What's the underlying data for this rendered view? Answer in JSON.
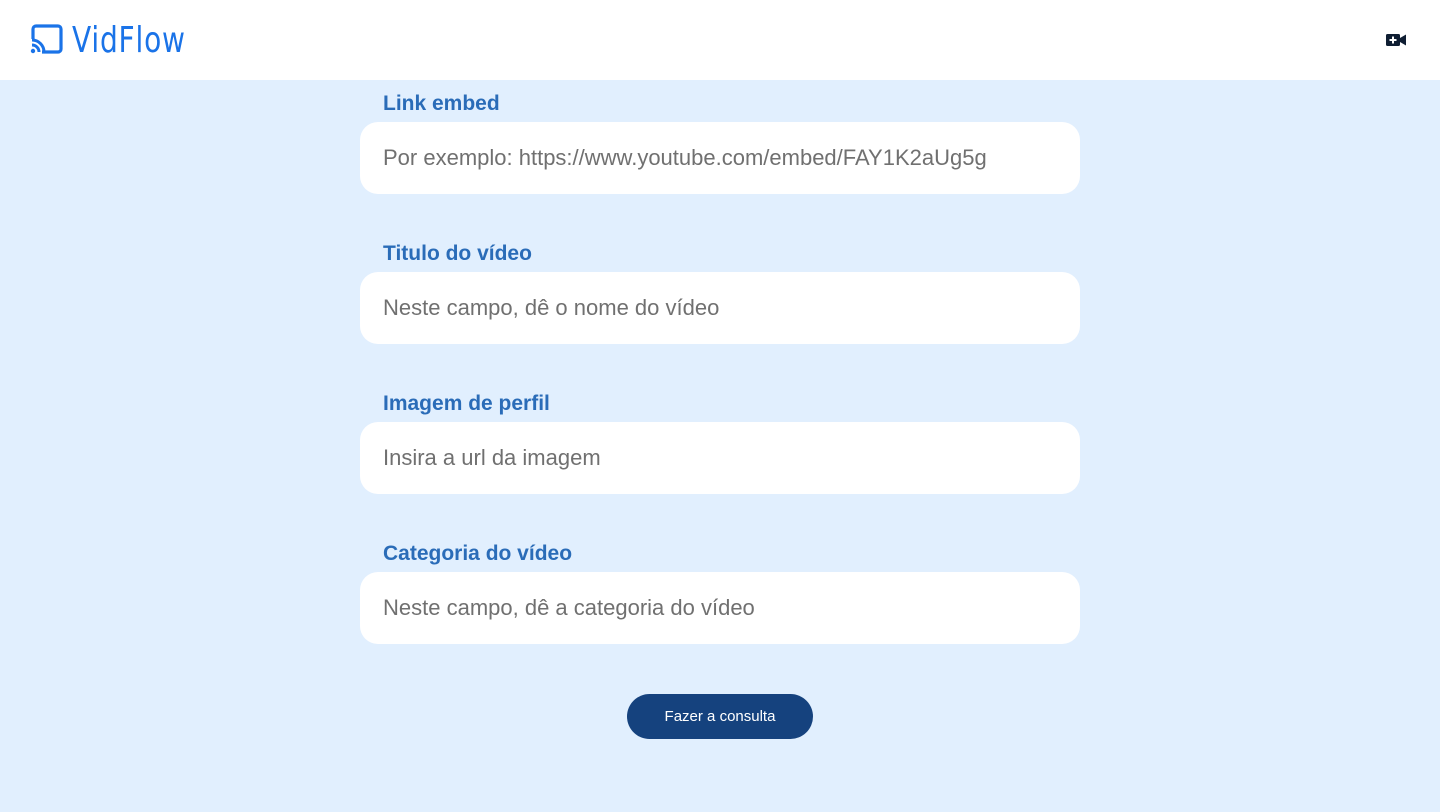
{
  "header": {
    "logo_text": "VidFlow",
    "logo_icon": "cast-icon",
    "new_video_icon": "video-camera-add-icon",
    "brand_color": "#1a73e8"
  },
  "form": {
    "fields": [
      {
        "label": "Link embed",
        "placeholder": "Por exemplo: https://www.youtube.com/embed/FAY1K2aUg5g"
      },
      {
        "label": "Titulo do vídeo",
        "placeholder": "Neste campo, dê o nome do vídeo"
      },
      {
        "label": "Imagem de perfil",
        "placeholder": "Insira a url da imagem"
      },
      {
        "label": "Categoria do vídeo",
        "placeholder": "Neste campo, dê a categoria do vídeo"
      }
    ],
    "submit_label": "Fazer a consulta"
  },
  "colors": {
    "background": "#e1effe",
    "label": "#2a6cb8",
    "button": "#15427e"
  }
}
